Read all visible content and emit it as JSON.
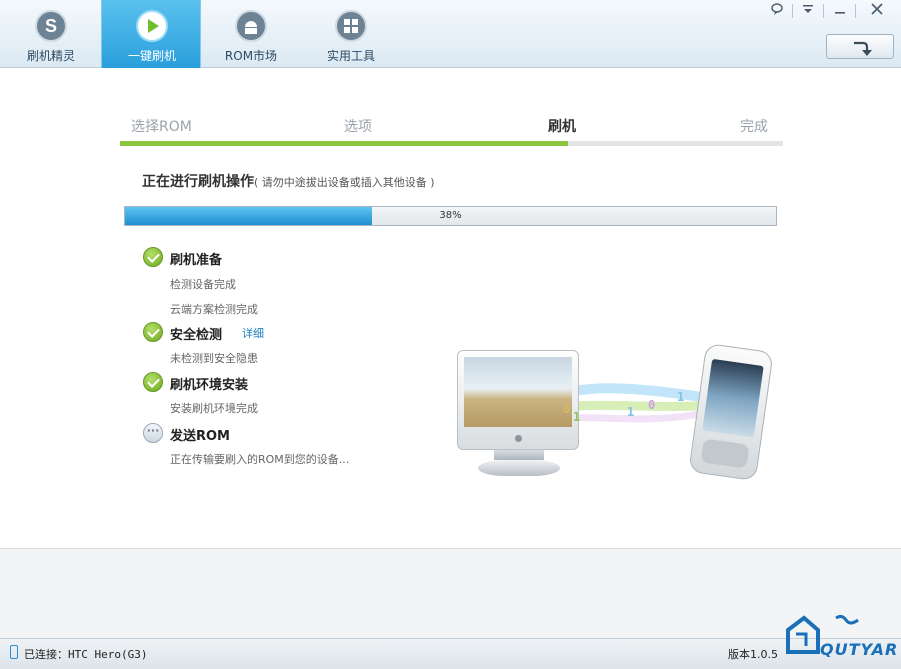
{
  "tabs": [
    {
      "label": "刷机精灵",
      "icon": "s-logo-icon",
      "active": false
    },
    {
      "label": "一键刷机",
      "icon": "play-icon",
      "active": true
    },
    {
      "label": "ROM市场",
      "icon": "android-icon",
      "active": false
    },
    {
      "label": "实用工具",
      "icon": "grid-icon",
      "active": false
    }
  ],
  "window_buttons": [
    "feedback-icon",
    "menu-icon",
    "minimize-icon",
    "close-icon"
  ],
  "steps": [
    "选择ROM",
    "选项",
    "刷机",
    "完成"
  ],
  "current_step_index": 2,
  "operation": {
    "title": "正在进行刷机操作",
    "hint": "( 请勿中途拔出设备或插入其他设备 )"
  },
  "progress": {
    "percent": 38,
    "label": "38%"
  },
  "tasks": [
    {
      "title": "刷机准备",
      "status": "done",
      "details": [
        "检测设备完成",
        "云端方案检测完成"
      ]
    },
    {
      "title": "安全检测",
      "status": "done",
      "link": "详细",
      "details": [
        "未检测到安全隐患"
      ]
    },
    {
      "title": "刷机环境安装",
      "status": "done",
      "details": [
        "安装刷机环境完成"
      ]
    },
    {
      "title": "发送ROM",
      "status": "pending",
      "details": [
        "正在传输要刷入的ROM到您的设备..."
      ]
    }
  ],
  "status": {
    "connected": "已连接：HTC Hero(G3)",
    "version": "版本1.0.5"
  },
  "watermark": "QUTYAR",
  "colors": {
    "accent": "#2a9fdc",
    "progress": "#1e8fd0",
    "step_done": "#8cc63f"
  }
}
